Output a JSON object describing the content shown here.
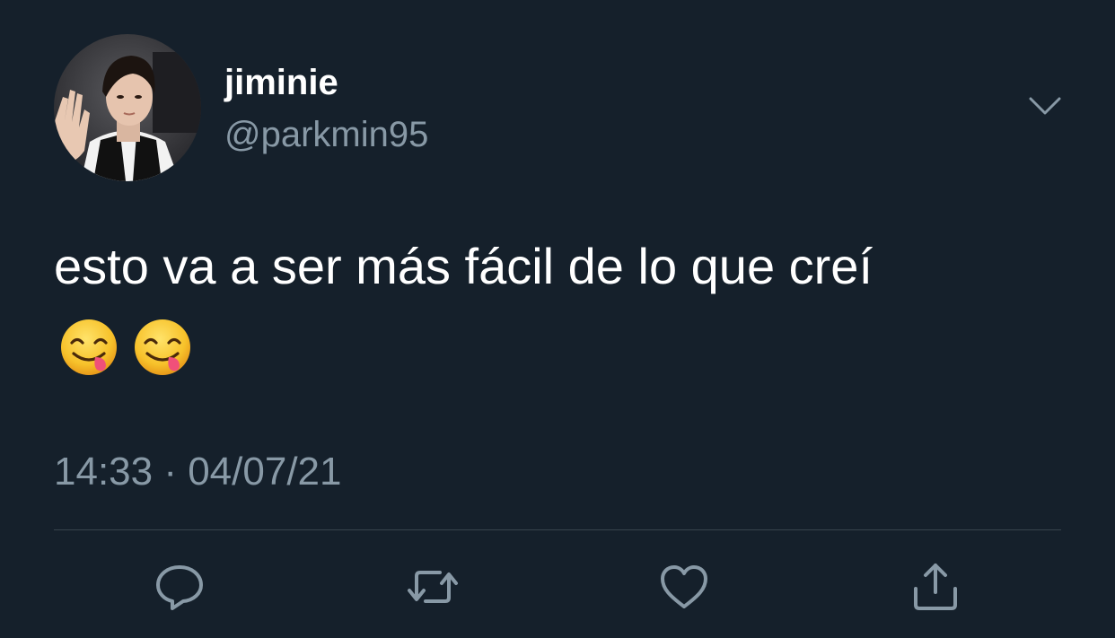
{
  "user": {
    "display_name": "jiminie",
    "handle": "@parkmin95",
    "avatar_icon": "profile-photo"
  },
  "menu": {
    "icon": "chevron-down-icon"
  },
  "tweet": {
    "text": "esto va a ser más fácil de lo que creí",
    "emojis": [
      "😋",
      "😋"
    ],
    "timestamp": "14:33 · 04/07/21"
  },
  "actions": [
    {
      "name": "reply",
      "icon": "reply-icon"
    },
    {
      "name": "retweet",
      "icon": "retweet-icon"
    },
    {
      "name": "like",
      "icon": "heart-icon"
    },
    {
      "name": "share",
      "icon": "share-icon"
    }
  ],
  "colors": {
    "background": "#15202b",
    "primary_text": "#ffffff",
    "secondary_text": "#8899a6",
    "divider": "#38444d"
  }
}
